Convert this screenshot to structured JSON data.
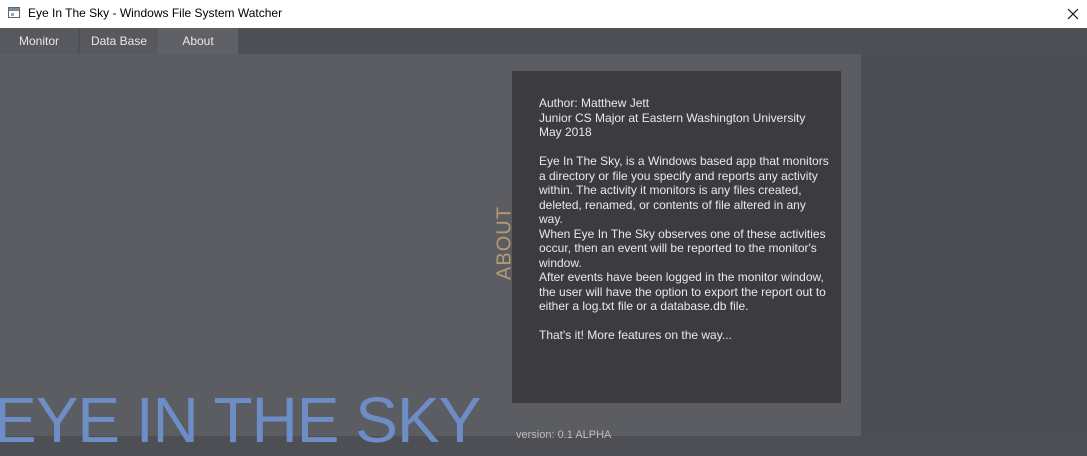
{
  "window": {
    "title": "Eye In The Sky - Windows File System Watcher"
  },
  "tabs": [
    {
      "label": "Monitor"
    },
    {
      "label": "Data Base"
    },
    {
      "label": "About",
      "active": true
    }
  ],
  "about": {
    "heading": "ABOUT",
    "author": "Author: Matthew Jett",
    "major": "Junior CS Major at Eastern Washington University",
    "date": "May 2018",
    "description_1": "Eye In The Sky, is a Windows based app that monitors a directory or file you specify and reports any activity within. The activity it monitors is any files created, deleted, renamed, or contents of file altered in any way.",
    "description_2": "When Eye In The Sky observes one of these activities occur, then an event will be reported to the monitor's window.",
    "description_3": "After events have been logged in the monitor window, the user will have the option to export the report out to either a log.txt file or a database.db file.",
    "closing": "That's it! More features on the way..."
  },
  "hero": {
    "title": "EYE IN THE SKY",
    "version": "version: 0.1 ALPHA"
  },
  "icons": {
    "app": "app-window-icon",
    "close": "close-icon"
  },
  "colors": {
    "hero_blue": "#6d8dc7",
    "about_heading_tan": "#b39a72",
    "panel_dark": "#3c3b40"
  }
}
